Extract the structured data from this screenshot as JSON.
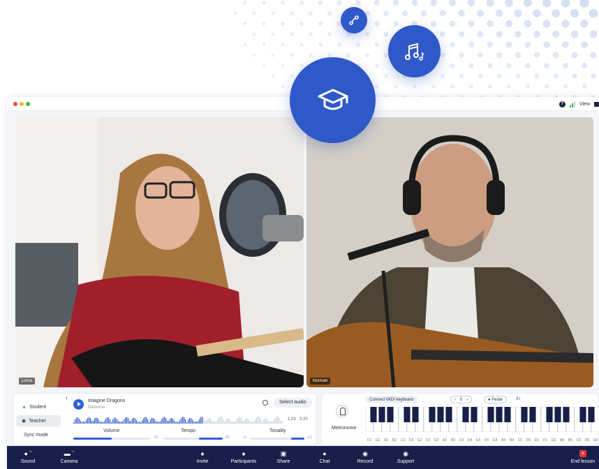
{
  "colors": {
    "accent": "#2f59c9",
    "taskbar": "#16204a",
    "end_lesson": "#e83535",
    "signal": "#3bb34a"
  },
  "topbar": {
    "view_label": "View"
  },
  "videos": [
    {
      "name": "Lorna"
    },
    {
      "name": "Norman"
    }
  ],
  "roles": {
    "student": "Student",
    "teacher": "Teacher",
    "sync_mode": "Sync mode"
  },
  "player": {
    "song": "Imagine Dragons",
    "artist": "Demons",
    "select_audio": "Select audio",
    "time_current": "1:23",
    "time_total": "3:20",
    "progress": 0.62,
    "volume": {
      "label": "Volume",
      "value": "50",
      "level": 0.5
    },
    "tempo": {
      "label": "Tempo",
      "value": "80",
      "level": 0.4
    },
    "tonality": {
      "label": "Tonality",
      "min": "-11",
      "max": "+11",
      "level": 0.5
    }
  },
  "metronome": {
    "label": "Metronome"
  },
  "keyboard": {
    "connect": "Connect MIDI keyboard",
    "octave": "0",
    "pedal": "Pedal",
    "notes": [
      "F2",
      "G2",
      "A2",
      "B2",
      "C3",
      "D3",
      "E3",
      "F3",
      "G3",
      "A3",
      "B3",
      "C4",
      "D4",
      "E4",
      "F4",
      "G4",
      "A4",
      "B4",
      "C5",
      "D5",
      "E5",
      "F5",
      "G5",
      "A5",
      "B5",
      "C6",
      "D6",
      "E6"
    ]
  },
  "taskbar": {
    "items": [
      {
        "label": "Sound",
        "icon": "microphone-icon"
      },
      {
        "label": "Camera",
        "icon": "camera-icon"
      },
      {
        "label": "Invite",
        "icon": "invite-icon"
      },
      {
        "label": "Participants",
        "icon": "participants-icon"
      },
      {
        "label": "Share",
        "icon": "share-icon"
      },
      {
        "label": "Chat",
        "icon": "chat-icon"
      },
      {
        "label": "Record",
        "icon": "record-icon"
      },
      {
        "label": "Support",
        "icon": "support-icon"
      }
    ],
    "end_lesson": "End lesson"
  }
}
